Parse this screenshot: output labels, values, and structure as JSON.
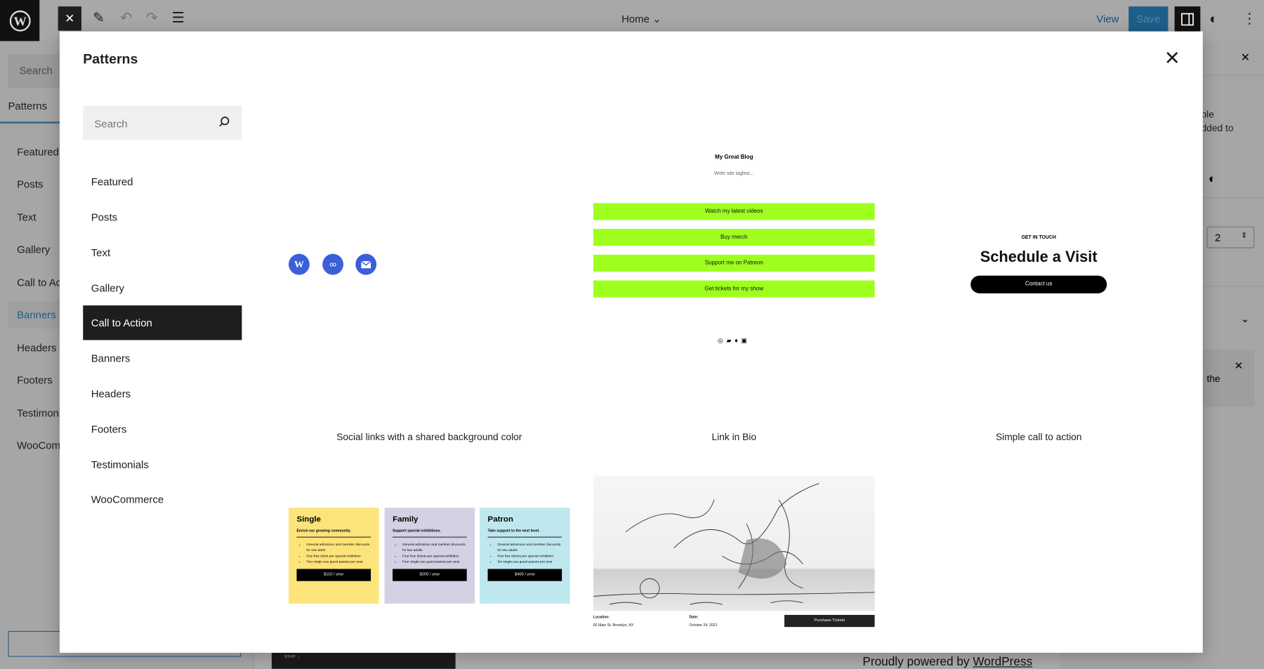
{
  "topbar": {
    "home_label": "Home",
    "view_label": "View",
    "save_label": "Save"
  },
  "left_sidebar": {
    "search_placeholder": "Search",
    "tab_label": "Patterns",
    "items": [
      "Featured",
      "Posts",
      "Text",
      "Gallery",
      "Call to Ac",
      "Banners",
      "Headers",
      "Footers",
      "Testimoni",
      "WooComm"
    ],
    "active_item": "Banners"
  },
  "right_sidebar": {
    "text_line1": "ple",
    "text_line2": "dded to",
    "number_value": "2",
    "notice_text": "the"
  },
  "canvas": {
    "rsvp_label": "RSVP →",
    "powered_prefix": "Proudly powered by ",
    "powered_link": "WordPress"
  },
  "modal": {
    "title": "Patterns",
    "search_placeholder": "Search",
    "categories": [
      "Featured",
      "Posts",
      "Text",
      "Gallery",
      "Call to Action",
      "Banners",
      "Headers",
      "Footers",
      "Testimonials",
      "WooCommerce"
    ],
    "active_category": "Call to Action",
    "patterns": [
      {
        "label": "Social links with a shared background color",
        "icons": [
          "wordpress-icon",
          "chain-link-icon",
          "mail-icon"
        ]
      },
      {
        "label": "Link in Bio",
        "site_title": "My Great Blog",
        "tagline": "Write site tagline...",
        "buttons": [
          "Watch my latest videos",
          "Buy merch",
          "Support me on Patreon",
          "Get tickets for my show"
        ],
        "social_icons": [
          "instagram-icon",
          "bandcamp-icon",
          "twitter-icon",
          "twitch-icon"
        ]
      },
      {
        "label": "Simple call to action",
        "kicker": "GET IN TOUCH",
        "heading": "Schedule a Visit",
        "button": "Contact us"
      },
      {
        "tiers": [
          {
            "name": "Single",
            "tagline": "Enrich our growing community.",
            "features": [
              "General admission and member discounts for one adult",
              "One free ticket per special exhibition",
              "Two single-use guest passes per year"
            ],
            "price": "$110 / year",
            "color": "#fde47a"
          },
          {
            "name": "Family",
            "tagline": "Support special exhibitions.",
            "features": [
              "General admission and member discounts for two adults",
              "Four free tickets per special exhibition",
              "Four single-use guest passes per year"
            ],
            "price": "$200 / year",
            "color": "#d3d1e3"
          },
          {
            "name": "Patron",
            "tagline": "Take support to the next level.",
            "features": [
              "General admission and member discounts for two adults",
              "Five free tickets per special exhibition",
              "Six single-use guest passes per year"
            ],
            "price": "$400 / year",
            "color": "#bfe8ee"
          }
        ]
      },
      {
        "location_label": "Location:",
        "location": "82 Main St. Brooklyn, NY",
        "date_label": "Date:",
        "date": "October 24, 2021",
        "button": "Purchase Tickets"
      }
    ]
  },
  "colors": {
    "accent": "#1d5f8a",
    "lime": "#9eff1f",
    "social_blue": "#3a5fd9"
  }
}
